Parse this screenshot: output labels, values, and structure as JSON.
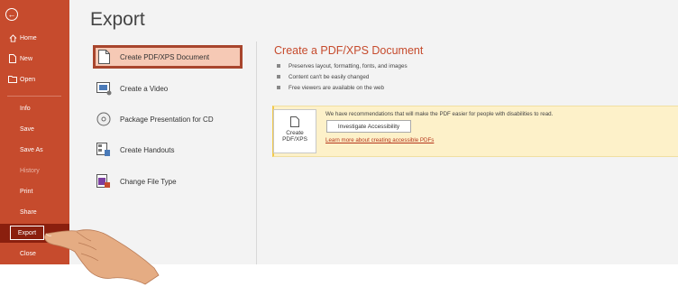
{
  "sidebar": {
    "items": [
      {
        "label": "Home",
        "icon": "home-icon"
      },
      {
        "label": "New",
        "icon": "new-file-icon"
      },
      {
        "label": "Open",
        "icon": "folder-icon"
      }
    ],
    "lower_items": [
      "Info",
      "Save",
      "Save As",
      "History",
      "Print",
      "Share"
    ],
    "export_label": "Export",
    "close_label": "Close"
  },
  "main": {
    "title": "Export",
    "options": [
      {
        "label": "Create PDF/XPS Document",
        "icon": "pdf-document-icon",
        "selected": true
      },
      {
        "label": "Create a Video",
        "icon": "video-icon"
      },
      {
        "label": "Package Presentation for CD",
        "icon": "cd-icon"
      },
      {
        "label": "Create Handouts",
        "icon": "handouts-icon"
      },
      {
        "label": "Change File Type",
        "icon": "file-type-icon"
      }
    ]
  },
  "detail": {
    "title": "Create a PDF/XPS Document",
    "bullets": [
      "Preserves layout, formatting, fonts, and images",
      "Content can't be easily changed",
      "Free viewers are available on the web"
    ],
    "create_button_line1": "Create",
    "create_button_line2": "PDF/XPS",
    "notice_text": "We have recommendations that will make the PDF easier for people with disabilities to read.",
    "investigate_button": "Investigate Accessibility",
    "learn_link": "Learn more about creating accessible PDFs"
  },
  "colors": {
    "sidebar": "#c64b2d",
    "export_selected": "#8a1f0e",
    "accent_text": "#c64b2d",
    "notice_bg": "#fdf1c9"
  }
}
